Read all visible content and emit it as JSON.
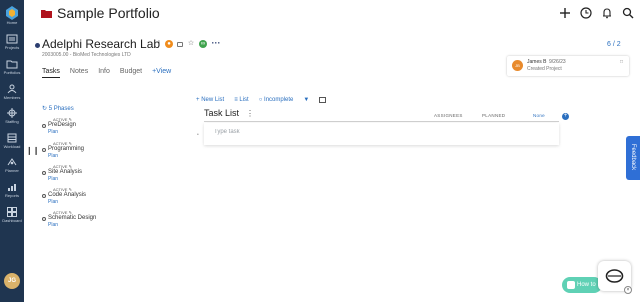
{
  "sidebar": {
    "logo": "app-logo",
    "items": [
      {
        "label": "Home",
        "icon": "home-icon"
      },
      {
        "label": "Projects",
        "icon": "projects-icon"
      },
      {
        "label": "Portfolios",
        "icon": "folder-icon"
      },
      {
        "label": "Members",
        "icon": "members-icon"
      },
      {
        "label": "Staffing",
        "icon": "staffing-icon"
      },
      {
        "label": "Workload",
        "icon": "workload-icon"
      },
      {
        "label": "Planner",
        "icon": "planner-icon"
      },
      {
        "label": "Reports",
        "icon": "reports-icon"
      },
      {
        "label": "Dashboard",
        "icon": "dashboard-icon"
      }
    ],
    "avatar_initials": "JG"
  },
  "header": {
    "title": "Sample Portfolio",
    "folder_color": "#b0131d"
  },
  "project": {
    "title": "Adelphi Research Lab",
    "subtitle": "2003005.00 - BioMed Technologies LTD",
    "counter": "6 / 2",
    "tabs": [
      {
        "label": "Tasks"
      },
      {
        "label": "Notes"
      },
      {
        "label": "Info"
      },
      {
        "label": "Budget"
      },
      {
        "label": "+View"
      }
    ]
  },
  "activity": {
    "user": "James B",
    "date": "9/26/23",
    "text": "Created Project",
    "avatar": "JB"
  },
  "phases": {
    "header": "5 Phases",
    "items": [
      {
        "status": "ACTIVE",
        "name": "PreDesign",
        "plan": "Plan"
      },
      {
        "status": "ACTIVE",
        "name": "Programming",
        "plan": "Plan"
      },
      {
        "status": "ACTIVE",
        "name": "Site Analysis",
        "plan": "Plan"
      },
      {
        "status": "ACTIVE",
        "name": "Code Analysis",
        "plan": "Plan"
      },
      {
        "status": "ACTIVE",
        "name": "Schematic Design",
        "plan": "Plan"
      }
    ]
  },
  "tasks": {
    "new_list": "New List",
    "list": "List",
    "incomplete": "Incomplete",
    "list_title": "Task List",
    "columns": {
      "assignees": "ASSIGNEES",
      "planned": "PLANNED",
      "none": "None"
    },
    "placeholder": "Type task"
  },
  "widgets": {
    "feedback": "Feedback",
    "howto": "How to"
  },
  "colors": {
    "sidebar": "#1f3550",
    "accent": "#2a6fbf",
    "feedback": "#2f6fd6",
    "howto": "#5fd1b5"
  }
}
